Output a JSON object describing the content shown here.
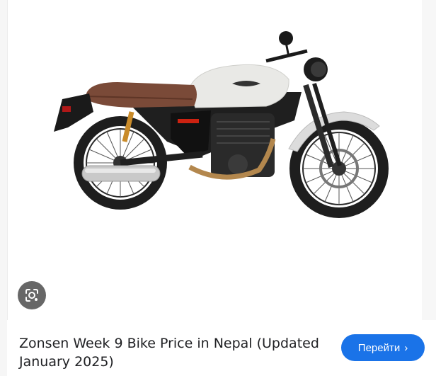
{
  "result": {
    "title": "Zonsen Week 9 Bike Price in Nepal (Updated January 2025)",
    "visit_button": "Перейти",
    "visit_icon": "chevron-right-icon",
    "lens_icon": "google-lens-icon",
    "image_subject": "motorcycle-image"
  },
  "colors": {
    "accent": "#1a73e8",
    "title_text": "#202124",
    "lens_bg": "#3c3c3c"
  }
}
